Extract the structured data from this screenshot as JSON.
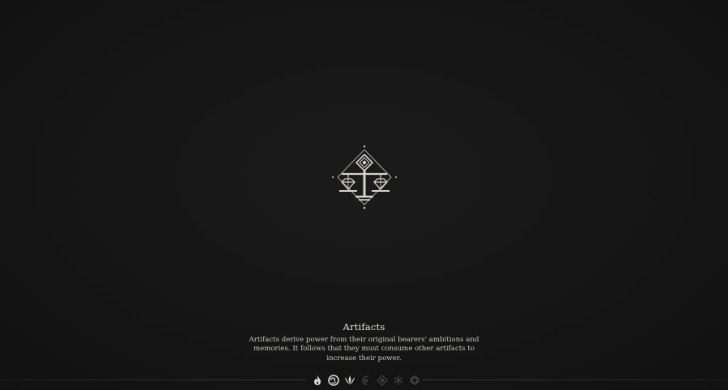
{
  "screen": {
    "title": "Artifacts",
    "description": "Artifacts derive power from their original bearers' ambitions and memories. It follows that they must consume other artifacts to increase their power."
  },
  "emblem": {
    "icon": "artifact-scales-icon"
  },
  "elements": [
    {
      "icon": "pyro-icon",
      "state": "unlocked"
    },
    {
      "icon": "hydro-icon",
      "state": "unlocked"
    },
    {
      "icon": "anemo-icon",
      "state": "unlocked"
    },
    {
      "icon": "electro-icon",
      "state": "locked"
    },
    {
      "icon": "dendro-icon",
      "state": "locked"
    },
    {
      "icon": "cryo-icon",
      "state": "locked"
    },
    {
      "icon": "geo-icon",
      "state": "locked"
    }
  ],
  "colors": {
    "background": "#161616",
    "text": "#e6e4df",
    "icon_active": "#dcdad6",
    "icon_inactive": "#5a5a5a"
  }
}
